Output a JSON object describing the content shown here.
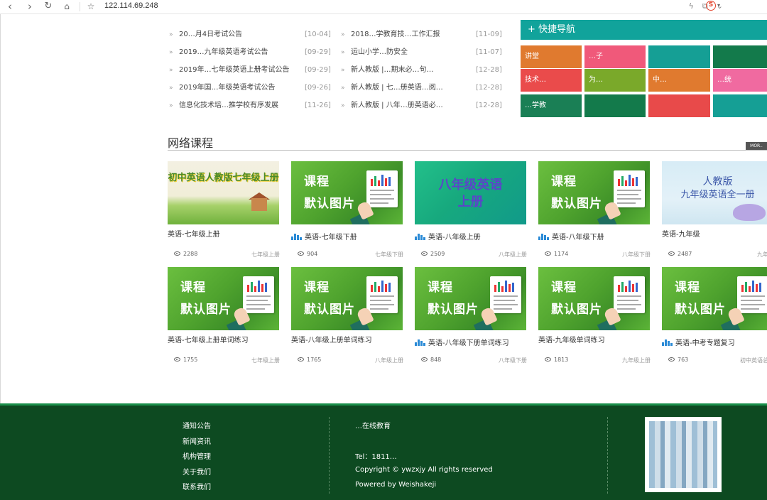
{
  "browser": {
    "back_icon": "back-arrow-icon",
    "forward_icon": "forward-arrow-icon",
    "reload_icon": "reload-icon",
    "home_icon": "home-icon",
    "bookmark_icon": "star-icon",
    "url": "122.114.69.248"
  },
  "news_left": [
    {
      "title": "20…月4日考试公告",
      "date": "[10-04]"
    },
    {
      "title": "2019…九年级英语考试公告",
      "date": "[09-29]"
    },
    {
      "title": "2019年…七年级英语上册考试公告",
      "date": "[09-29]"
    },
    {
      "title": "2019年国…年级英语考试公告",
      "date": "[09-26]"
    },
    {
      "title": "信息化技术培…推学校有序发展",
      "date": "[11-26]"
    }
  ],
  "news_right": [
    {
      "title": "2018…学教育技…工作汇报",
      "date": "[11-09]"
    },
    {
      "title": "运山小学…防安全",
      "date": "[11-07]"
    },
    {
      "title": "新人教版 |…期末必…句…",
      "date": "[12-28]"
    },
    {
      "title": "新人教版 | 七…册英语…阅…",
      "date": "[12-28]"
    },
    {
      "title": "新人教版 | 八年…册英语必…",
      "date": "[12-28]"
    }
  ],
  "quick_nav": {
    "title": "快捷导航",
    "tiles": [
      "讲堂",
      "…子",
      "",
      "",
      "技术…",
      "为…",
      "中…",
      "…统",
      "…学教",
      "",
      "",
      ""
    ]
  },
  "section": {
    "title": "网络课程",
    "more": "MOR.."
  },
  "thumb_text": {
    "course": "课程",
    "default_image": "默认图片",
    "landscape_title": "初中英语人教版七年级上册",
    "teal_title_1": "八年级英语",
    "teal_title_2": "上册",
    "sky_title_1": "人教版",
    "sky_title_2": "九年级英语全一册"
  },
  "courses_row1": [
    {
      "name": "英语-七年级上册",
      "views": "2288",
      "grade": "七年级上册"
    },
    {
      "name": "英语-七年级下册",
      "views": "904",
      "grade": "七年级下册"
    },
    {
      "name": "英语-八年级上册",
      "views": "2509",
      "grade": "八年级上册"
    },
    {
      "name": "英语-八年级下册",
      "views": "1174",
      "grade": "八年级下册"
    },
    {
      "name": "英语-九年级",
      "views": "2487",
      "grade": "九年级"
    }
  ],
  "courses_row2": [
    {
      "name": "英语-七年级上册单词练习",
      "views": "1755",
      "grade": "七年级上册"
    },
    {
      "name": "英语-八年级上册单词练习",
      "views": "1765",
      "grade": "八年级上册"
    },
    {
      "name": "英语-八年级下册单词练习",
      "views": "848",
      "grade": "八年级下册"
    },
    {
      "name": "英语-九年级单词练习",
      "views": "1813",
      "grade": "九年级上册"
    },
    {
      "name": "英语-中考专题复习",
      "views": "763",
      "grade": "初中英语总复"
    }
  ],
  "footer": {
    "links": [
      "通知公告",
      "新闻资讯",
      "机构管理",
      "关于我们",
      "联系我们"
    ],
    "org": "…在线教育",
    "address": "",
    "tel": "Tel：1811…",
    "copyright": "Copyright © ywzxjy All rights reserved",
    "powered": "Powered by Weishakeji"
  },
  "colors": {
    "quick_head": "#11a39b",
    "footer_bg": "#0d4a21",
    "tile_colors": [
      "#e07a2f",
      "#f0597a",
      "#159f95",
      "#137a4b",
      "#ea4b4b",
      "#7aa92a",
      "#e07a2f",
      "#f06aa0",
      "#1a7f55",
      "#137a4b",
      "#e84a4a",
      "#159f95"
    ]
  }
}
